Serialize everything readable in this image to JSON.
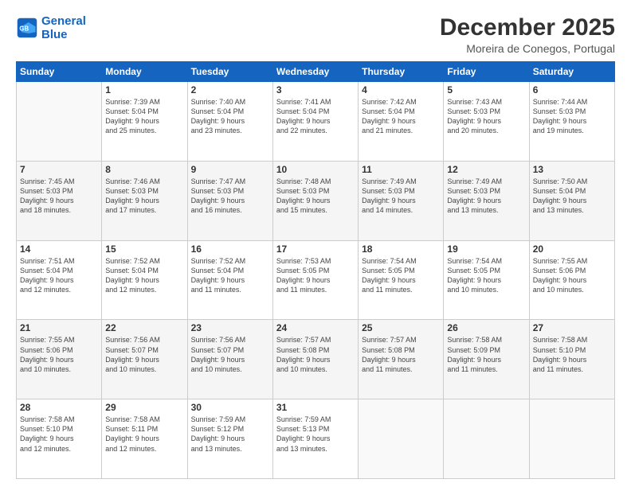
{
  "header": {
    "logo_line1": "General",
    "logo_line2": "Blue",
    "month": "December 2025",
    "location": "Moreira de Conegos, Portugal"
  },
  "weekdays": [
    "Sunday",
    "Monday",
    "Tuesday",
    "Wednesday",
    "Thursday",
    "Friday",
    "Saturday"
  ],
  "weeks": [
    [
      {
        "day": "",
        "info": ""
      },
      {
        "day": "1",
        "info": "Sunrise: 7:39 AM\nSunset: 5:04 PM\nDaylight: 9 hours\nand 25 minutes."
      },
      {
        "day": "2",
        "info": "Sunrise: 7:40 AM\nSunset: 5:04 PM\nDaylight: 9 hours\nand 23 minutes."
      },
      {
        "day": "3",
        "info": "Sunrise: 7:41 AM\nSunset: 5:04 PM\nDaylight: 9 hours\nand 22 minutes."
      },
      {
        "day": "4",
        "info": "Sunrise: 7:42 AM\nSunset: 5:04 PM\nDaylight: 9 hours\nand 21 minutes."
      },
      {
        "day": "5",
        "info": "Sunrise: 7:43 AM\nSunset: 5:03 PM\nDaylight: 9 hours\nand 20 minutes."
      },
      {
        "day": "6",
        "info": "Sunrise: 7:44 AM\nSunset: 5:03 PM\nDaylight: 9 hours\nand 19 minutes."
      }
    ],
    [
      {
        "day": "7",
        "info": "Sunrise: 7:45 AM\nSunset: 5:03 PM\nDaylight: 9 hours\nand 18 minutes."
      },
      {
        "day": "8",
        "info": "Sunrise: 7:46 AM\nSunset: 5:03 PM\nDaylight: 9 hours\nand 17 minutes."
      },
      {
        "day": "9",
        "info": "Sunrise: 7:47 AM\nSunset: 5:03 PM\nDaylight: 9 hours\nand 16 minutes."
      },
      {
        "day": "10",
        "info": "Sunrise: 7:48 AM\nSunset: 5:03 PM\nDaylight: 9 hours\nand 15 minutes."
      },
      {
        "day": "11",
        "info": "Sunrise: 7:49 AM\nSunset: 5:03 PM\nDaylight: 9 hours\nand 14 minutes."
      },
      {
        "day": "12",
        "info": "Sunrise: 7:49 AM\nSunset: 5:03 PM\nDaylight: 9 hours\nand 13 minutes."
      },
      {
        "day": "13",
        "info": "Sunrise: 7:50 AM\nSunset: 5:04 PM\nDaylight: 9 hours\nand 13 minutes."
      }
    ],
    [
      {
        "day": "14",
        "info": "Sunrise: 7:51 AM\nSunset: 5:04 PM\nDaylight: 9 hours\nand 12 minutes."
      },
      {
        "day": "15",
        "info": "Sunrise: 7:52 AM\nSunset: 5:04 PM\nDaylight: 9 hours\nand 12 minutes."
      },
      {
        "day": "16",
        "info": "Sunrise: 7:52 AM\nSunset: 5:04 PM\nDaylight: 9 hours\nand 11 minutes."
      },
      {
        "day": "17",
        "info": "Sunrise: 7:53 AM\nSunset: 5:05 PM\nDaylight: 9 hours\nand 11 minutes."
      },
      {
        "day": "18",
        "info": "Sunrise: 7:54 AM\nSunset: 5:05 PM\nDaylight: 9 hours\nand 11 minutes."
      },
      {
        "day": "19",
        "info": "Sunrise: 7:54 AM\nSunset: 5:05 PM\nDaylight: 9 hours\nand 10 minutes."
      },
      {
        "day": "20",
        "info": "Sunrise: 7:55 AM\nSunset: 5:06 PM\nDaylight: 9 hours\nand 10 minutes."
      }
    ],
    [
      {
        "day": "21",
        "info": "Sunrise: 7:55 AM\nSunset: 5:06 PM\nDaylight: 9 hours\nand 10 minutes."
      },
      {
        "day": "22",
        "info": "Sunrise: 7:56 AM\nSunset: 5:07 PM\nDaylight: 9 hours\nand 10 minutes."
      },
      {
        "day": "23",
        "info": "Sunrise: 7:56 AM\nSunset: 5:07 PM\nDaylight: 9 hours\nand 10 minutes."
      },
      {
        "day": "24",
        "info": "Sunrise: 7:57 AM\nSunset: 5:08 PM\nDaylight: 9 hours\nand 10 minutes."
      },
      {
        "day": "25",
        "info": "Sunrise: 7:57 AM\nSunset: 5:08 PM\nDaylight: 9 hours\nand 11 minutes."
      },
      {
        "day": "26",
        "info": "Sunrise: 7:58 AM\nSunset: 5:09 PM\nDaylight: 9 hours\nand 11 minutes."
      },
      {
        "day": "27",
        "info": "Sunrise: 7:58 AM\nSunset: 5:10 PM\nDaylight: 9 hours\nand 11 minutes."
      }
    ],
    [
      {
        "day": "28",
        "info": "Sunrise: 7:58 AM\nSunset: 5:10 PM\nDaylight: 9 hours\nand 12 minutes."
      },
      {
        "day": "29",
        "info": "Sunrise: 7:58 AM\nSunset: 5:11 PM\nDaylight: 9 hours\nand 12 minutes."
      },
      {
        "day": "30",
        "info": "Sunrise: 7:59 AM\nSunset: 5:12 PM\nDaylight: 9 hours\nand 13 minutes."
      },
      {
        "day": "31",
        "info": "Sunrise: 7:59 AM\nSunset: 5:13 PM\nDaylight: 9 hours\nand 13 minutes."
      },
      {
        "day": "",
        "info": ""
      },
      {
        "day": "",
        "info": ""
      },
      {
        "day": "",
        "info": ""
      }
    ]
  ]
}
